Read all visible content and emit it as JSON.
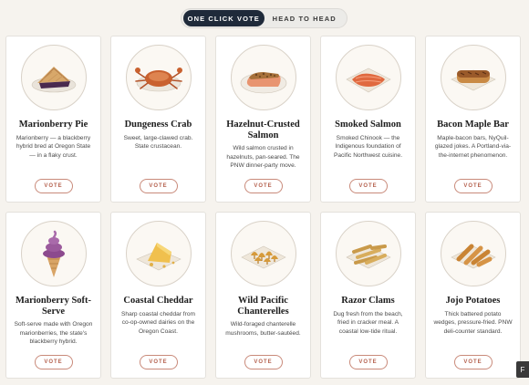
{
  "toggle": {
    "one_click": "ONE CLICK VOTE",
    "head_to_head": "HEAD TO HEAD"
  },
  "vote_label": "VOTE",
  "corner_label": "F",
  "foods": [
    {
      "name": "Marionberry Pie",
      "desc": "Marionberry — a blackberry hybrid bred at Oregon State — in a flaky crust.",
      "icon": "pie-icon"
    },
    {
      "name": "Dungeness Crab",
      "desc": "Sweet, large-clawed crab. State crustacean.",
      "icon": "crab-icon"
    },
    {
      "name": "Hazelnut-Crusted Salmon",
      "desc": "Wild salmon crusted in hazelnuts, pan-seared. The PNW dinner-party move.",
      "icon": "salmon-fillet-icon"
    },
    {
      "name": "Smoked Salmon",
      "desc": "Smoked Chinook — the Indigenous foundation of Pacific Northwest cuisine.",
      "icon": "smoked-salmon-icon"
    },
    {
      "name": "Bacon Maple Bar",
      "desc": "Maple-bacon bars, NyQuil-glazed jokes. A Portland-via-the-internet phenomenon.",
      "icon": "maple-bar-icon"
    },
    {
      "name": "Marionberry Soft-Serve",
      "desc": "Soft-serve made with Oregon marionberries, the state's blackberry hybrid.",
      "icon": "soft-serve-icon"
    },
    {
      "name": "Coastal Cheddar",
      "desc": "Sharp coastal cheddar from co-op-owned dairies on the Oregon Coast.",
      "icon": "cheese-icon"
    },
    {
      "name": "Wild Pacific Chanterelles",
      "desc": "Wild-foraged chanterelle mushrooms, butter-sautéed.",
      "icon": "chanterelles-icon"
    },
    {
      "name": "Razor Clams",
      "desc": "Dug fresh from the beach, fried in cracker meal. A coastal low-tide ritual.",
      "icon": "razor-clams-icon"
    },
    {
      "name": "Jojo Potatoes",
      "desc": "Thick battered potato wedges, pressure-fried. PNW deli-counter standard.",
      "icon": "jojo-potatoes-icon"
    }
  ]
}
